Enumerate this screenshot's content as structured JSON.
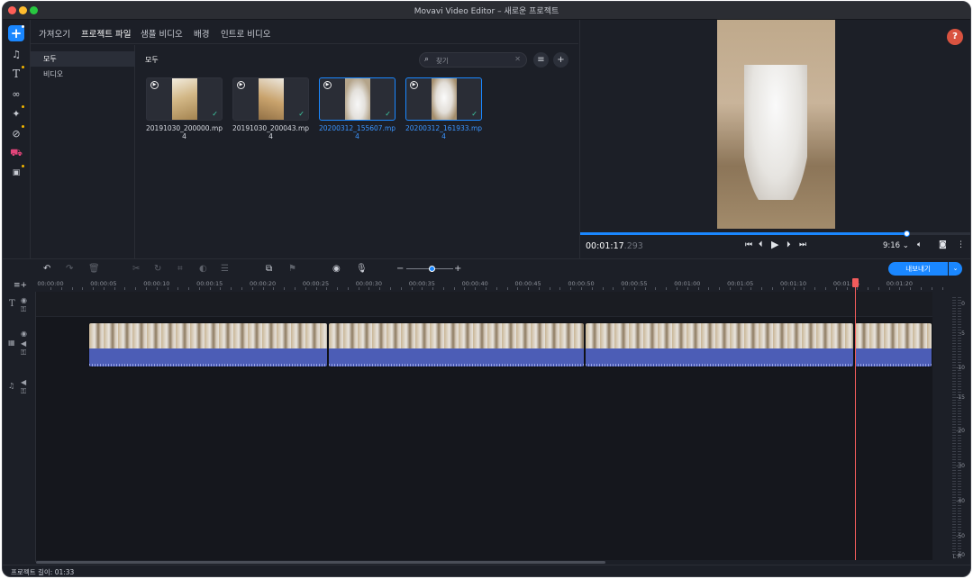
{
  "window": {
    "title": "Movavi Video Editor – 새로운 프로젝트"
  },
  "left_tools": [
    "add-icon",
    "music-icon",
    "text-icon",
    "transition-icon",
    "magic-wand-icon",
    "filter-icon",
    "sticker-icon",
    "more-tools-icon"
  ],
  "tabs": [
    {
      "label": "가져오기"
    },
    {
      "label": "프로젝트 파일"
    },
    {
      "label": "샘플 비디오"
    },
    {
      "label": "배경"
    },
    {
      "label": "인트로 비디오"
    }
  ],
  "categories": [
    {
      "label": "모두"
    },
    {
      "label": "비디오"
    }
  ],
  "media": {
    "heading": "모두",
    "search_placeholder": "찾기",
    "files": [
      {
        "name": "20191030_200000.mp4",
        "selected": false
      },
      {
        "name": "20191030_200043.mp4",
        "selected": false
      },
      {
        "name": "20200312_155607.mp4",
        "selected": true
      },
      {
        "name": "20200312_161933.mp4",
        "selected": true
      }
    ]
  },
  "preview": {
    "help_label": "?",
    "timecode_main": "00:01:17",
    "timecode_frames": ".293",
    "progress": 0.83,
    "aspect_ratio": "9:16"
  },
  "toolbar": {
    "export_label": "내보내기"
  },
  "timeline": {
    "ruler_ticks": [
      "00:00:00",
      "00:00:05",
      "00:00:10",
      "00:00:15",
      "00:00:20",
      "00:00:25",
      "00:00:30",
      "00:00:35",
      "00:00:40",
      "00:00:45",
      "00:00:50",
      "00:00:55",
      "00:01:00",
      "00:01:05",
      "00:01:10",
      "00:01:15",
      "00:01:20"
    ],
    "clips_count": 4
  },
  "meter": {
    "labels": [
      "0",
      "-5",
      "-10",
      "-15",
      "-20",
      "-30",
      "-40",
      "-50",
      "-60"
    ],
    "channels": [
      "L",
      "R"
    ]
  },
  "status": {
    "project_length": "프로젝트 길이: 01:33"
  }
}
